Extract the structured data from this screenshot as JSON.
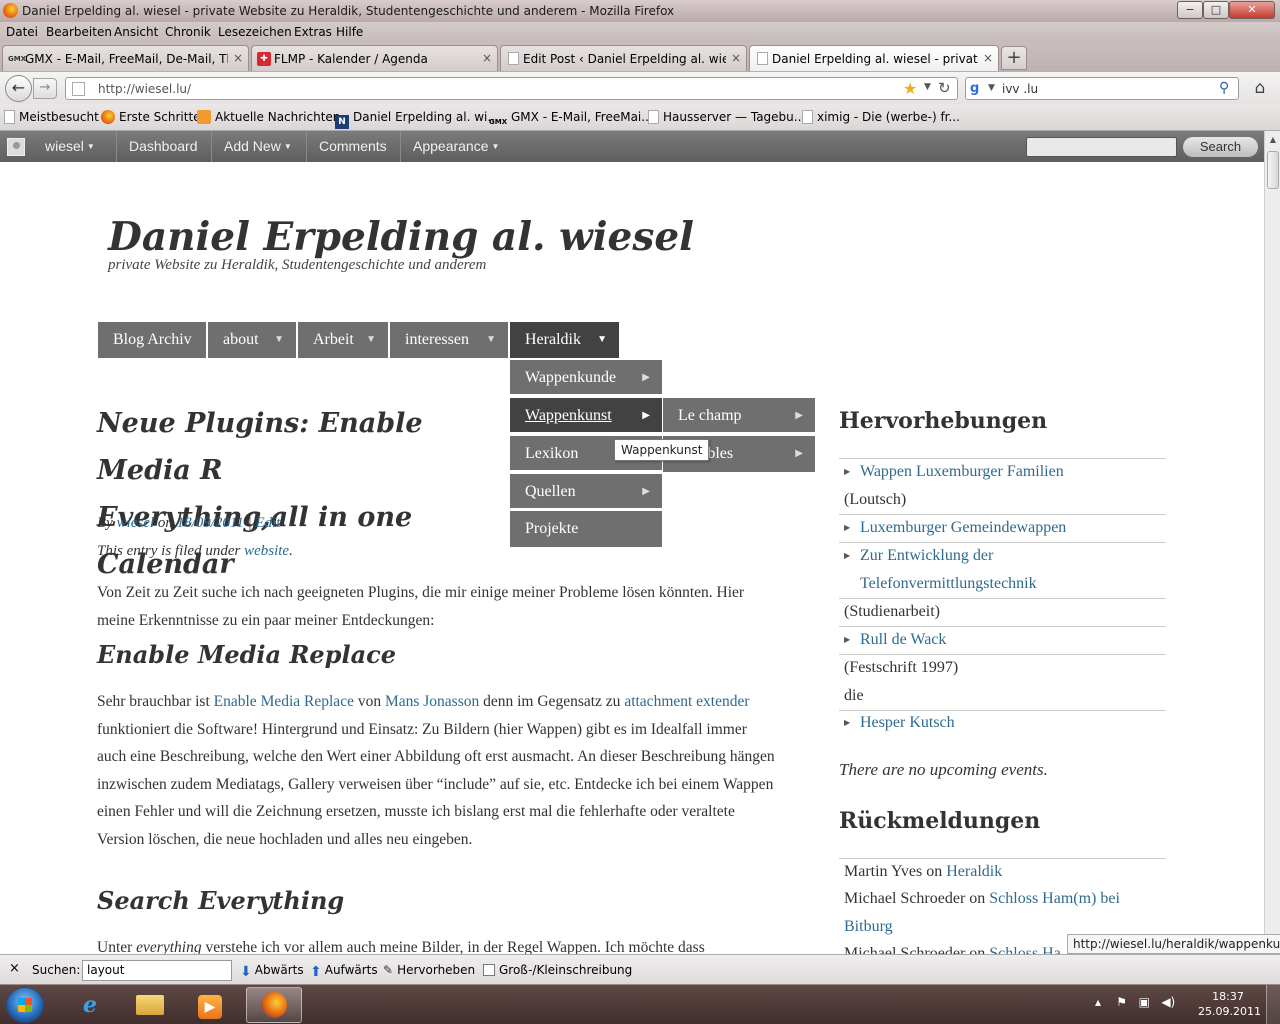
{
  "window": {
    "title": "Daniel Erpelding al. wiesel - private Website zu Heraldik, Studentengeschichte und anderem - Mozilla Firefox",
    "min": "−",
    "max": "□",
    "close": "✕"
  },
  "menu": [
    "Datei",
    "Bearbeiten",
    "Ansicht",
    "Chronik",
    "Lesezeichen",
    "Extras",
    "Hilfe"
  ],
  "tabs": [
    {
      "icon": "GMX",
      "label": "GMX - E-Mail, FreeMail, De-Mail, The...",
      "close": "×"
    },
    {
      "icon": "✚",
      "label": "FLMP - Kalender / Agenda",
      "close": "×"
    },
    {
      "icon": "",
      "label": "Edit Post ‹ Daniel Erpelding al. wiesel ...",
      "close": "×"
    },
    {
      "icon": "",
      "label": "Daniel Erpelding al. wiesel - private ...",
      "close": "×"
    }
  ],
  "new_tab": "+",
  "nav": {
    "back": "←",
    "forward": "→",
    "url": "http://wiesel.lu/",
    "search_value": "ivv .lu",
    "home": "⌂",
    "star": "★",
    "reload": "↻"
  },
  "bookmarks": [
    {
      "icon": "",
      "label": "Meistbesucht"
    },
    {
      "icon": "",
      "label": "Erste Schritte"
    },
    {
      "icon": "",
      "label": "Aktuelle Nachrichten"
    },
    {
      "icon": "N",
      "label": "Daniel Erpelding al. wi..."
    },
    {
      "icon": "GMX",
      "label": "GMX - E-Mail, FreeMai..."
    },
    {
      "icon": "",
      "label": "Hausserver — Tagebu..."
    },
    {
      "icon": "",
      "label": "ximig - Die (werbe-) fr..."
    }
  ],
  "adminbar": {
    "items": [
      "wiesel",
      "Dashboard",
      "Add New",
      "Comments",
      "Appearance"
    ],
    "search_button": "Search"
  },
  "site": {
    "title": "Daniel Erpelding al. wiesel",
    "description": "private Website zu Heraldik, Studentengeschichte und anderem"
  },
  "primary_nav": [
    "Blog Archiv",
    "about",
    "Arbeit",
    "interessen",
    "Heraldik"
  ],
  "heraldik_menu": [
    "Wappenkunde",
    "Wappenkunst",
    "Lexikon",
    "Quellen",
    "Projekte"
  ],
  "wappenkunst_menu": [
    "Le champ",
    "Meubles"
  ],
  "tooltip": "Wappenkunst",
  "post": {
    "title": "Neue Plugins: Enable Media Replace, Search Everything,all in one Calendar",
    "title_line1": "Neue Plugins: Enable Media R",
    "title_line2": "Everything,all in one Calendar",
    "meta_by": "By",
    "meta_author": "wiesel",
    "meta_on": "on",
    "meta_date": "18/09/2011",
    "meta_sep": "|",
    "meta_edit": "Edit",
    "filed_under": "This entry is filed under",
    "category": "website",
    "intro": "Von Zeit zu Zeit suche ich nach geeigneten Plugins, die mir einige meiner Probleme lösen könnten. Hier meine Erkenntnisse zu ein paar meiner Entdeckungen:",
    "h_emr": "Enable Media Replace",
    "emr_p1": "Sehr brauchbar ist",
    "emr_link1": "Enable Media Replace",
    "emr_p2": "von",
    "emr_link2": "Mans Jonasson",
    "emr_p3": "denn im Gegensatz zu",
    "emr_link3": "attachment extender",
    "emr_p4": "funktioniert die Software! Hintergrund und Einsatz: Zu Bildern (hier Wappen) gibt es im Idealfall immer auch eine Beschreibung, welche den Wert einer Abbildung oft erst ausmacht. An dieser Beschreibung hängen inzwischen zudem Mediatags, Gallery verweisen über “include” auf sie, etc. Entdecke ich bei einem Wappen einen Fehler und will die Zeichnung ersetzen, musste ich bislang erst mal die fehlerhafte oder veraltete Version löschen, die neue hochladen und alles neu eingeben.",
    "h_se": "Search Everything",
    "se_p1": "Unter",
    "se_em": "everything",
    "se_p2": "verstehe ich vor allem auch meine Bilder, in der Regel Wappen. Ich möchte dass"
  },
  "sidebar": {
    "highlights_title": "Hervorhebungen",
    "highlights": [
      {
        "type": "link",
        "text": "Wappen Luxemburger Familien"
      },
      {
        "type": "text",
        "text": "(Loutsch)"
      },
      {
        "type": "link",
        "text": "Luxemburger Gemeindewappen"
      },
      {
        "type": "link",
        "text": "Zur Entwicklung der"
      },
      {
        "type": "link2",
        "text": "Telefonvermittlungstechnik"
      },
      {
        "type": "text",
        "text": "(Studienarbeit)"
      },
      {
        "type": "link",
        "text": "Rull de Wack"
      },
      {
        "type": "text",
        "text": "(Festschrift 1997)"
      },
      {
        "type": "text",
        "text": "die"
      },
      {
        "type": "link",
        "text": "Hesper Kutsch"
      }
    ],
    "no_events": "There are no upcoming events.",
    "comments_title": "Rückmeldungen",
    "comments": [
      {
        "author": "Martin Yves",
        "on": "on",
        "post": "Heraldik"
      },
      {
        "author": "Michael Schroeder",
        "on": "on",
        "post": "Schloss Ham(m) bei"
      },
      {
        "author": "",
        "on": "",
        "post": "Bitburg"
      },
      {
        "author": "Michael Schroeder",
        "on": "on",
        "post": "Schloss Ha"
      }
    ]
  },
  "status_url": "http://wiesel.lu/heraldik/wappenkunst/",
  "findbar": {
    "close": "×",
    "label": "Suchen:",
    "value": "layout",
    "down": "Abwärts",
    "up": "Aufwärts",
    "highlight": "Hervorheben",
    "match_case": "Groß-/Kleinschreibung"
  },
  "taskbar": {
    "time": "18:37",
    "date": "25.09.2011"
  }
}
